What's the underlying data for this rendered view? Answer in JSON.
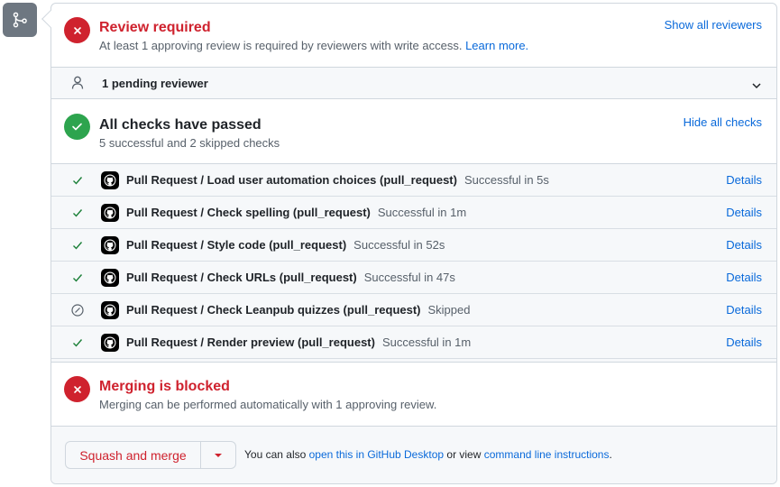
{
  "review": {
    "title": "Review required",
    "description": "At least 1 approving review is required by reviewers with write access.",
    "learn_more": "Learn more.",
    "show_all_reviewers": "Show all reviewers",
    "pending_label": "1 pending reviewer"
  },
  "checks": {
    "title": "All checks have passed",
    "summary": "5 successful and 2 skipped checks",
    "hide_all": "Hide all checks",
    "details_label": "Details",
    "items": [
      {
        "name": "Pull Request / Load user automation choices (pull_request)",
        "status": "Successful in 5s",
        "state": "success"
      },
      {
        "name": "Pull Request / Check spelling (pull_request)",
        "status": "Successful in 1m",
        "state": "success"
      },
      {
        "name": "Pull Request / Style code (pull_request)",
        "status": "Successful in 52s",
        "state": "success"
      },
      {
        "name": "Pull Request / Check URLs (pull_request)",
        "status": "Successful in 47s",
        "state": "success"
      },
      {
        "name": "Pull Request / Check Leanpub quizzes (pull_request)",
        "status": "Skipped",
        "state": "skipped"
      },
      {
        "name": "Pull Request / Render preview (pull_request)",
        "status": "Successful in 1m",
        "state": "success"
      }
    ]
  },
  "merge": {
    "title": "Merging is blocked",
    "description": "Merging can be performed automatically with 1 approving review.",
    "button_label": "Squash and merge",
    "note_prefix": "You can also",
    "desktop_link": "open this in GitHub Desktop",
    "note_middle": "or view",
    "cli_link": "command line instructions",
    "note_suffix": "."
  },
  "colors": {
    "danger": "#cf222e",
    "success": "#2da44e",
    "link": "#0969da",
    "muted": "#57606a"
  }
}
